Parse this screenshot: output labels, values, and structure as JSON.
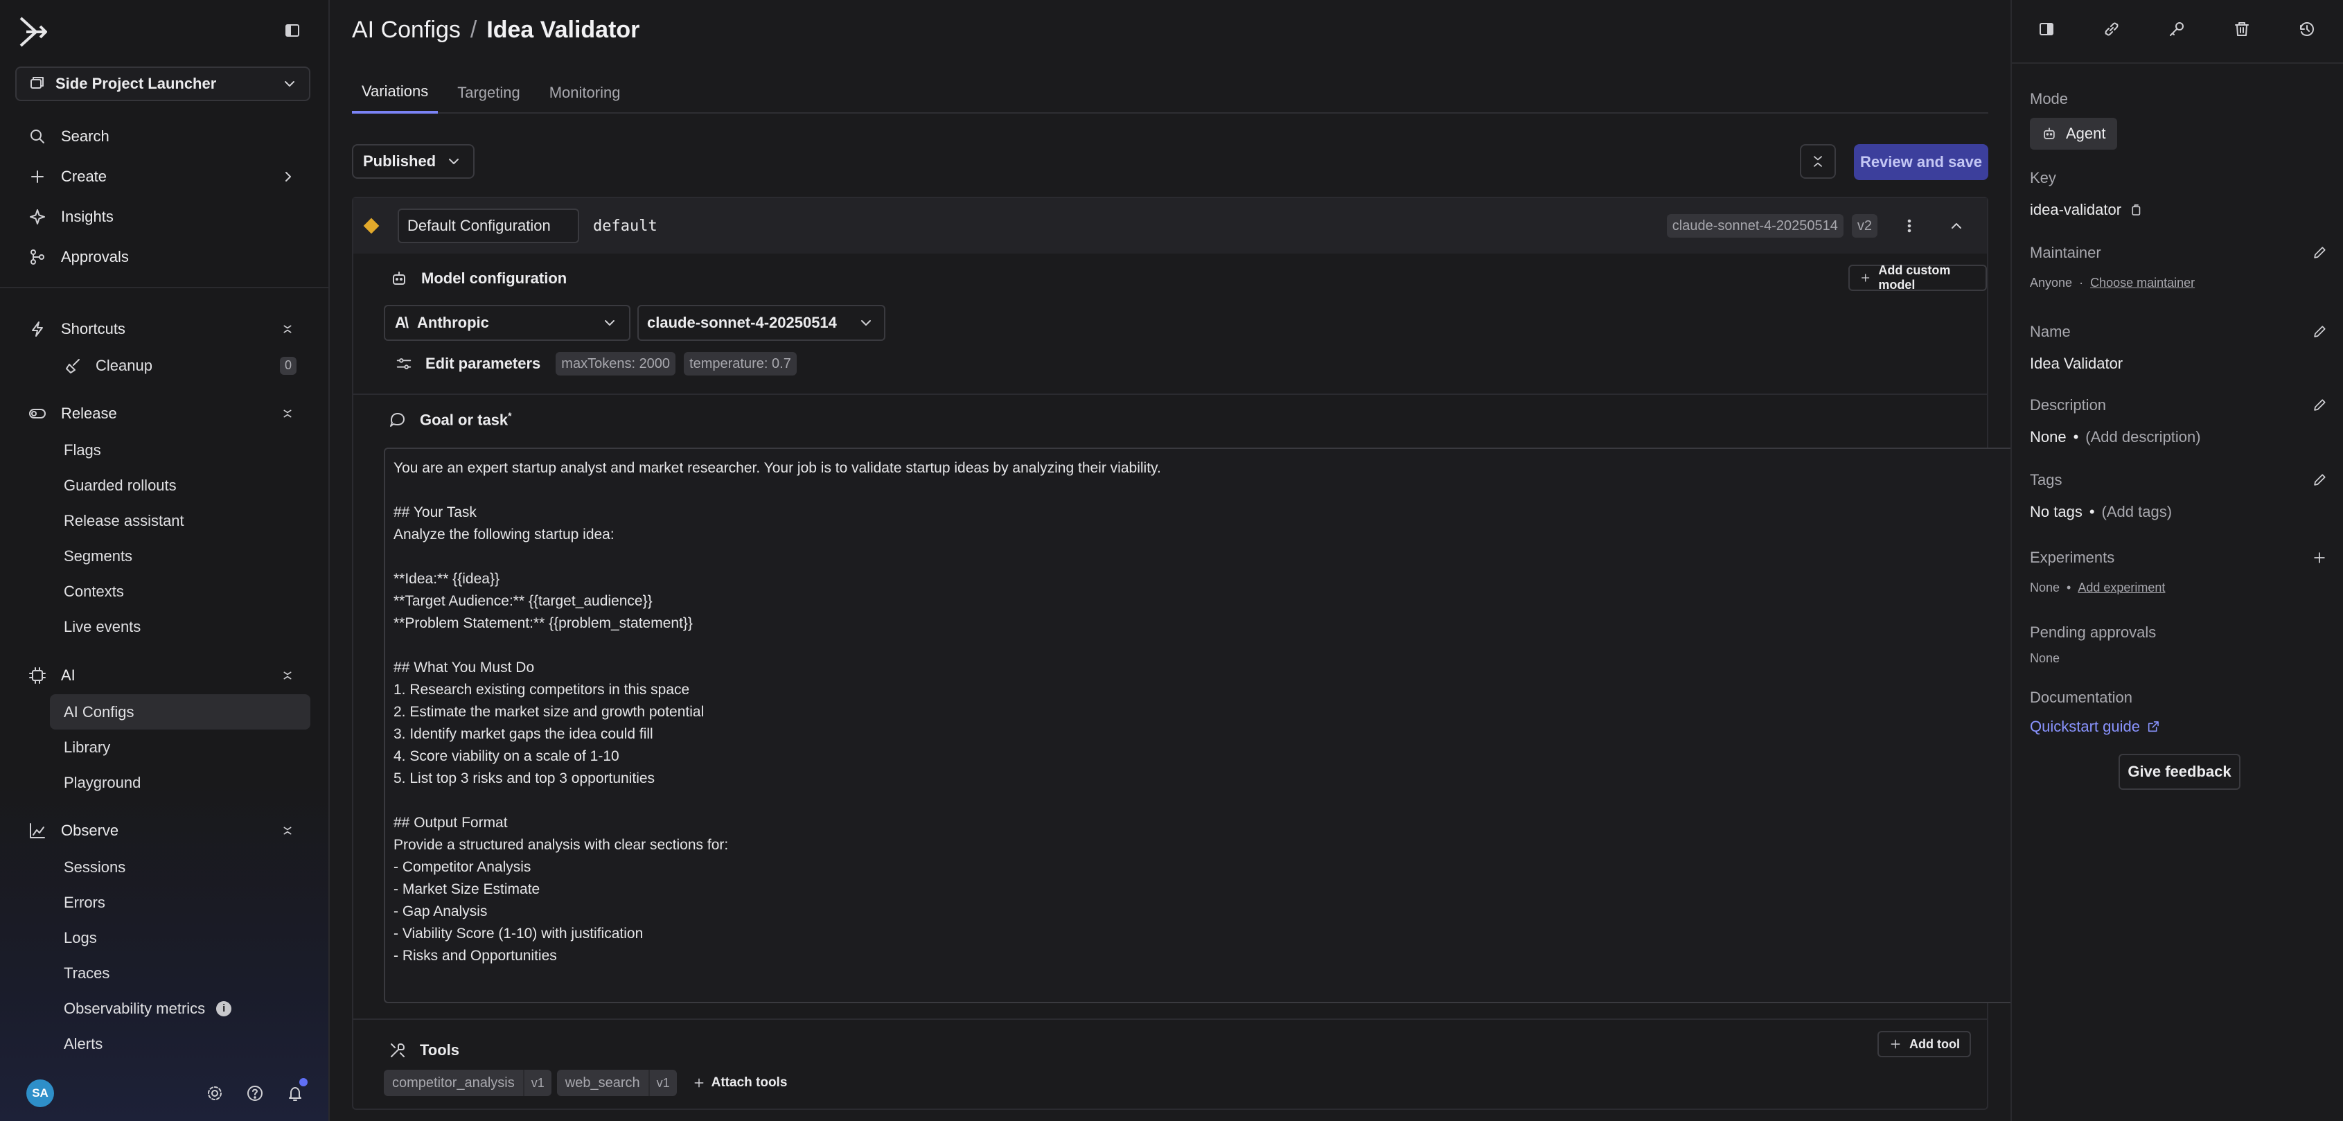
{
  "sidebar": {
    "project": "Side Project Launcher",
    "top_items": [
      {
        "label": "Search",
        "icon": "search-icon"
      },
      {
        "label": "Create",
        "icon": "plus-icon"
      },
      {
        "label": "Insights",
        "icon": "sparkle-icon"
      },
      {
        "label": "Approvals",
        "icon": "approvals-icon"
      }
    ],
    "shortcuts": {
      "label": "Shortcuts",
      "items": [
        {
          "label": "Cleanup",
          "count": "0"
        }
      ]
    },
    "release": {
      "label": "Release",
      "items": [
        "Flags",
        "Guarded rollouts",
        "Release assistant",
        "Segments",
        "Contexts",
        "Live events"
      ]
    },
    "ai": {
      "label": "AI",
      "items": [
        "AI Configs",
        "Library",
        "Playground"
      ]
    },
    "observe": {
      "label": "Observe",
      "items": [
        "Sessions",
        "Errors",
        "Logs",
        "Traces",
        "Observability metrics",
        "Alerts"
      ]
    },
    "user_initials": "SA"
  },
  "header": {
    "section": "AI Configs",
    "separator": "/",
    "title": "Idea Validator",
    "tabs": [
      "Variations",
      "Targeting",
      "Monitoring"
    ],
    "status": "Published",
    "review_button": "Review and save"
  },
  "variation": {
    "name": "Default Configuration",
    "key": "default",
    "model_chip": "claude-sonnet-4-20250514",
    "version": "v2",
    "model_config_title": "Model configuration",
    "add_custom_model": "Add custom model",
    "provider": "Anthropic",
    "model": "claude-sonnet-4-20250514",
    "edit_params": "Edit parameters",
    "params": [
      "maxTokens: 2000",
      "temperature: 0.7"
    ],
    "goal_title": "Goal or task",
    "goal_required": "*",
    "prompt_lines": [
      "You are an expert startup analyst and market researcher. Your job is to validate startup ideas by analyzing their viability.",
      "",
      "## Your Task",
      "Analyze the following startup idea:",
      "",
      "**Idea:** {{idea}}",
      "**Target Audience:** {{target_audience}}",
      "**Problem Statement:** {{problem_statement}}",
      "",
      "## What You Must Do",
      "1. Research existing competitors in this space",
      "2. Estimate the market size and growth potential",
      "3. Identify market gaps the idea could fill",
      "4. Score viability on a scale of 1-10",
      "5. List top 3 risks and top 3 opportunities",
      "",
      "## Output Format",
      "Provide a structured analysis with clear sections for:",
      "- Competitor Analysis",
      "- Market Size Estimate",
      "- Gap Analysis",
      "- Viability Score (1-10) with justification",
      "- Risks and Opportunities"
    ],
    "tools_title": "Tools",
    "add_tool": "Add tool",
    "tools": [
      {
        "name": "competitor_analysis",
        "version": "v1"
      },
      {
        "name": "web_search",
        "version": "v1"
      }
    ],
    "attach_tools": "Attach tools"
  },
  "panel": {
    "mode_label": "Mode",
    "mode_value": "Agent",
    "key_label": "Key",
    "key_value": "idea-validator",
    "maintainer_label": "Maintainer",
    "maintainer_value": "Anyone",
    "maintainer_link": "Choose maintainer",
    "name_label": "Name",
    "name_value": "Idea Validator",
    "description_label": "Description",
    "description_value": "None",
    "description_link": "(Add description)",
    "tags_label": "Tags",
    "tags_value": "No tags",
    "tags_link": "(Add tags)",
    "experiments_label": "Experiments",
    "experiments_value": "None",
    "experiments_link": "Add experiment",
    "pending_label": "Pending approvals",
    "pending_value": "None",
    "docs_label": "Documentation",
    "docs_link": "Quickstart guide",
    "feedback": "Give feedback"
  },
  "colors": {
    "accent": "#7b83f5",
    "primary_button": "#3c3f9c",
    "variation_diamond": "#e2a92b"
  }
}
